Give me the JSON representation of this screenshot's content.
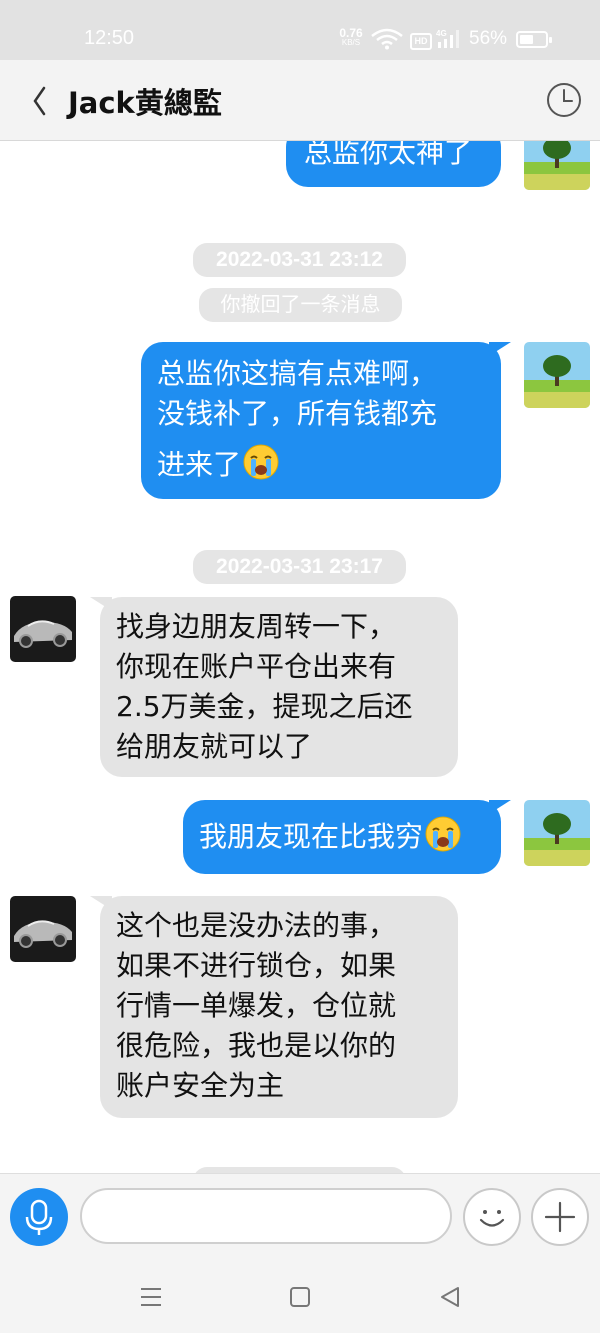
{
  "status_bar": {
    "time": "12:50",
    "network_speed": "0.76",
    "network_unit": "KB/S",
    "hd_label": "HD",
    "signal_label": "4G",
    "battery_percent": "56%",
    "battery_level": 0.56
  },
  "header": {
    "title": "Jack黄總監",
    "back_icon": "chevron-left-icon",
    "history_icon": "clock-icon"
  },
  "messages": [
    {
      "type": "outgoing",
      "lines": [
        "总监你太神了"
      ]
    },
    {
      "type": "timestamp",
      "text": "2022-03-31 23:12"
    },
    {
      "type": "notice",
      "text": "你撤回了一条消息"
    },
    {
      "type": "outgoing",
      "lines": [
        "总监你这搞有点难啊，",
        "没钱补了，所有钱都充",
        "进来了"
      ],
      "emoji": "crying-emoji"
    },
    {
      "type": "timestamp",
      "text": "2022-03-31 23:17"
    },
    {
      "type": "incoming",
      "lines": [
        "找身边朋友周转一下，",
        "你现在账户平仓出来有",
        "2.5万美金，提现之后还",
        "给朋友就可以了"
      ]
    },
    {
      "type": "outgoing",
      "lines": [
        "我朋友现在比我穷"
      ],
      "emoji": "crying-emoji"
    },
    {
      "type": "incoming",
      "lines": [
        "这个也是没办法的事，",
        "如果不进行锁仓，如果",
        "行情一单爆发，仓位就",
        "很危险，我也是以你的",
        "账户安全为主"
      ]
    }
  ],
  "input_bar": {
    "voice_icon": "microphone-icon",
    "text_value": "",
    "emoji_icon": "smiley-icon",
    "more_icon": "plus-icon"
  },
  "nav_bar": {
    "menu_icon": "menu-icon",
    "home_icon": "square-icon",
    "back_icon": "triangle-back-icon"
  },
  "colors": {
    "outgoing_bubble": "#1f8ef1",
    "incoming_bubble": "#e4e4e4",
    "accent": "#1f8ef1"
  }
}
